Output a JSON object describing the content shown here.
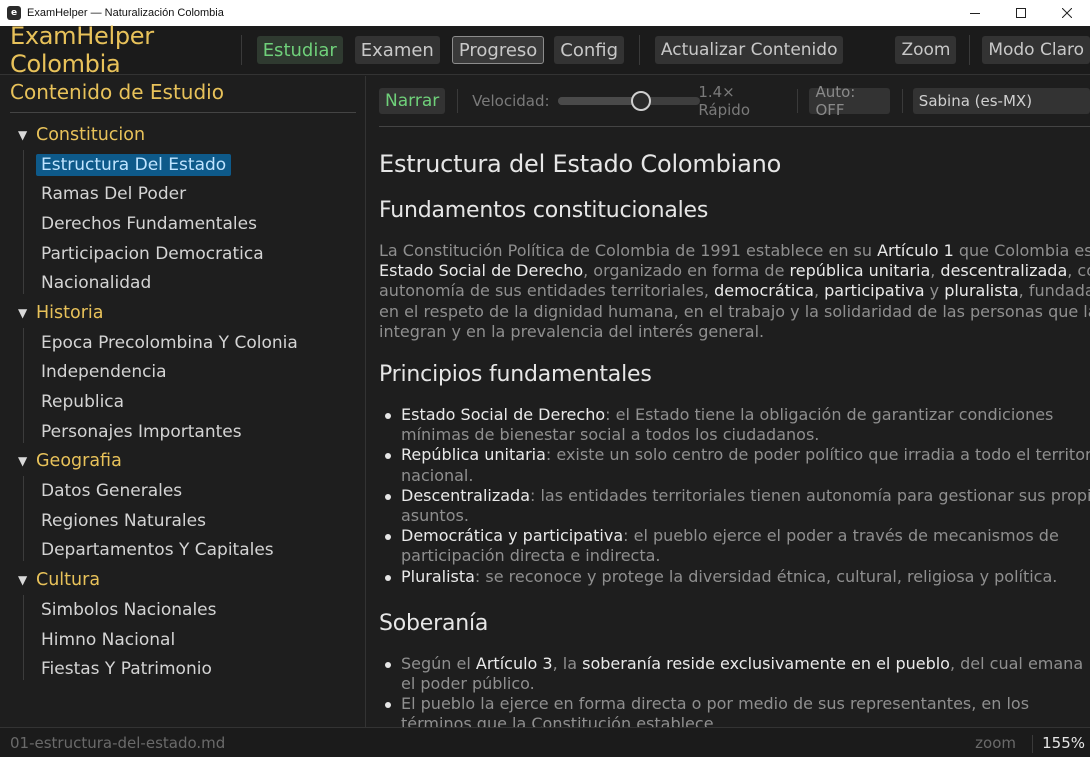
{
  "window": {
    "icon_letter": "e",
    "title": "ExamHelper — Naturalización Colombia",
    "controls": [
      "minimize",
      "maximize",
      "close"
    ]
  },
  "toolbar": {
    "brand": "ExamHelper Colombia",
    "tabs": [
      {
        "label": "Estudiar",
        "state": "active"
      },
      {
        "label": "Examen",
        "state": "normal"
      },
      {
        "label": "Progreso",
        "state": "focused"
      },
      {
        "label": "Config",
        "state": "normal"
      }
    ],
    "update_label": "Actualizar Contenido",
    "zoom_label": "Zoom",
    "theme_label": "Modo Claro"
  },
  "sidebar": {
    "title": "Contenido de Estudio",
    "categories": [
      {
        "label": "Constitucion",
        "items": [
          "Estructura Del Estado",
          "Ramas Del Poder",
          "Derechos Fundamentales",
          "Participacion Democratica",
          "Nacionalidad"
        ]
      },
      {
        "label": "Historia",
        "items": [
          "Epoca Precolombina Y Colonia",
          "Independencia",
          "Republica",
          "Personajes Importantes"
        ]
      },
      {
        "label": "Geografia",
        "items": [
          "Datos Generales",
          "Regiones Naturales",
          "Departamentos Y Capitales"
        ]
      },
      {
        "label": "Cultura",
        "items": [
          "Simbolos Nacionales",
          "Himno Nacional",
          "Fiestas Y Patrimonio"
        ]
      }
    ],
    "selected": "Estructura Del Estado"
  },
  "player": {
    "narrate_label": "Narrar",
    "speed_label": "Velocidad:",
    "speed_fraction": 0.63,
    "speed_value": "1.4× Rápido",
    "auto_label": "Auto: OFF",
    "voice": "Sabina (es-MX)"
  },
  "document": {
    "title": "Estructura del Estado Colombiano",
    "s1_heading": "Fundamentos constitucionales",
    "s1_p": [
      {
        "t": "La Constitución Política de Colombia de 1991 establece en su "
      },
      {
        "t": "Artículo 1",
        "b": true
      },
      {
        "t": " que Colombia es un "
      },
      {
        "t": "Estado Social de Derecho",
        "b": true
      },
      {
        "t": ", organizado en forma de "
      },
      {
        "t": "república unitaria",
        "b": true
      },
      {
        "t": ", "
      },
      {
        "t": "descentralizada",
        "b": true
      },
      {
        "t": ", con autonomía de sus entidades territoriales, "
      },
      {
        "t": "democrática",
        "b": true
      },
      {
        "t": ", "
      },
      {
        "t": "participativa",
        "b": true
      },
      {
        "t": " y "
      },
      {
        "t": "pluralista",
        "b": true
      },
      {
        "t": ", fundada en el respeto de la dignidad humana, en el trabajo y la solidaridad de las personas que la integran y en la prevalencia del interés general."
      }
    ],
    "s2_heading": "Principios fundamentales",
    "s2_list": [
      {
        "term": "Estado Social de Derecho",
        "text": ": el Estado tiene la obligación de garantizar condiciones mínimas de bienestar social a todos los ciudadanos."
      },
      {
        "term": "República unitaria",
        "text": ": existe un solo centro de poder político que irradia a todo el territorio nacional."
      },
      {
        "term": "Descentralizada",
        "text": ": las entidades territoriales tienen autonomía para gestionar sus propios asuntos."
      },
      {
        "term": "Democrática y participativa",
        "text": ": el pueblo ejerce el poder a través de mecanismos de participación directa e indirecta."
      },
      {
        "term": "Pluralista",
        "text": ": se reconoce y protege la diversidad étnica, cultural, religiosa y política."
      }
    ],
    "s3_heading": "Soberanía",
    "s3_list": [
      [
        {
          "t": "Según el "
        },
        {
          "t": "Artículo 3",
          "b": true
        },
        {
          "t": ", la "
        },
        {
          "t": "soberanía reside exclusivamente en el pueblo",
          "b": true
        },
        {
          "t": ", del cual emana el poder público."
        }
      ],
      [
        {
          "t": "El pueblo la ejerce en forma directa o por medio de sus representantes, en los términos que la Constitución establece."
        }
      ]
    ]
  },
  "status": {
    "file": "01-estructura-del-estado.md",
    "zoom_label": "zoom",
    "zoom_value": "155%"
  }
}
